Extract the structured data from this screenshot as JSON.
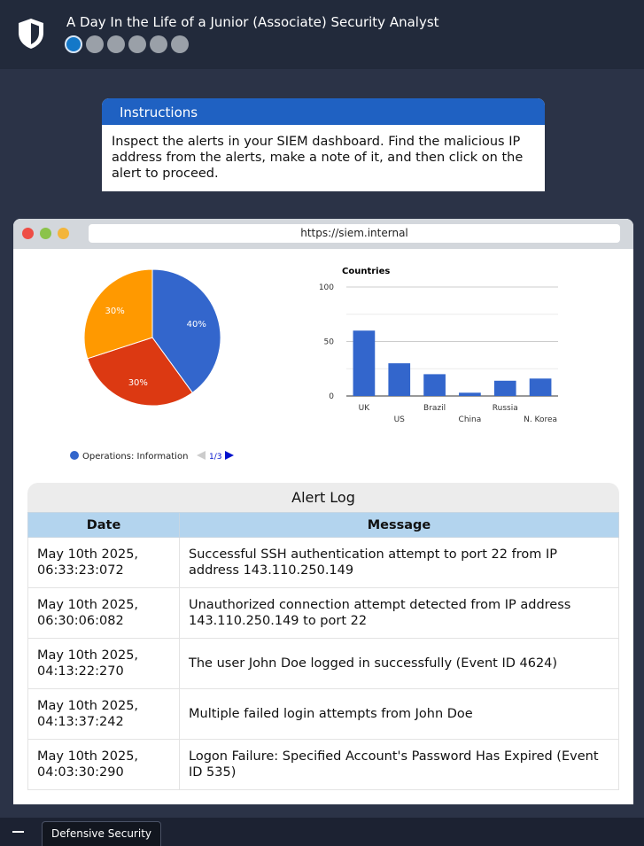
{
  "header": {
    "title": "A Day In the Life of a Junior (Associate) Security Analyst",
    "logo_icon": "shield-icon",
    "progress": {
      "total_steps": 6,
      "current_step": 1
    }
  },
  "instructions": {
    "heading": "Instructions",
    "body": "Inspect the alerts in your SIEM dashboard. Find the malicious IP address from the alerts, make a note of it, and then click on the alert to proceed."
  },
  "browser": {
    "url": "https://siem.internal"
  },
  "chart_data": [
    {
      "type": "pie",
      "slices": [
        {
          "label": "40%",
          "value": 40,
          "color": "#3366cc"
        },
        {
          "label": "30%",
          "value": 30,
          "color": "#dc3912"
        },
        {
          "label": "30%",
          "value": 30,
          "color": "#ff9900"
        }
      ],
      "legend": {
        "entry": "Operations: Information",
        "color": "#3366cc",
        "page": "1/3",
        "position": "bottom"
      }
    },
    {
      "type": "bar",
      "title": "Countries",
      "categories": [
        "UK",
        "US",
        "Brazil",
        "China",
        "Russia",
        "N. Korea"
      ],
      "values": [
        60,
        30,
        20,
        3,
        14,
        16
      ],
      "ylim": [
        0,
        100
      ],
      "yticks": [
        0,
        50,
        100
      ],
      "grid": true,
      "color": "#3366cc"
    }
  ],
  "alert_log": {
    "title": "Alert Log",
    "columns": [
      "Date",
      "Message"
    ],
    "rows": [
      {
        "date": "May 10th 2025, 06:33:23:072",
        "message": "Successful SSH authentication attempt to port 22 from IP address 143.110.250.149"
      },
      {
        "date": "May 10th 2025, 06:30:06:082",
        "message": "Unauthorized connection attempt detected from IP address 143.110.250.149 to port 22"
      },
      {
        "date": "May 10th 2025, 04:13:22:270",
        "message": "The user John Doe logged in successfully (Event ID 4624)"
      },
      {
        "date": "May 10th 2025, 04:13:37:242",
        "message": "Multiple failed login attempts from John Doe"
      },
      {
        "date": "May 10th 2025, 04:03:30:290",
        "message": "Logon Failure: Specified Account's Password Has Expired (Event ID 535)"
      }
    ]
  },
  "taskbar": {
    "tab_label": "Defensive Security"
  }
}
